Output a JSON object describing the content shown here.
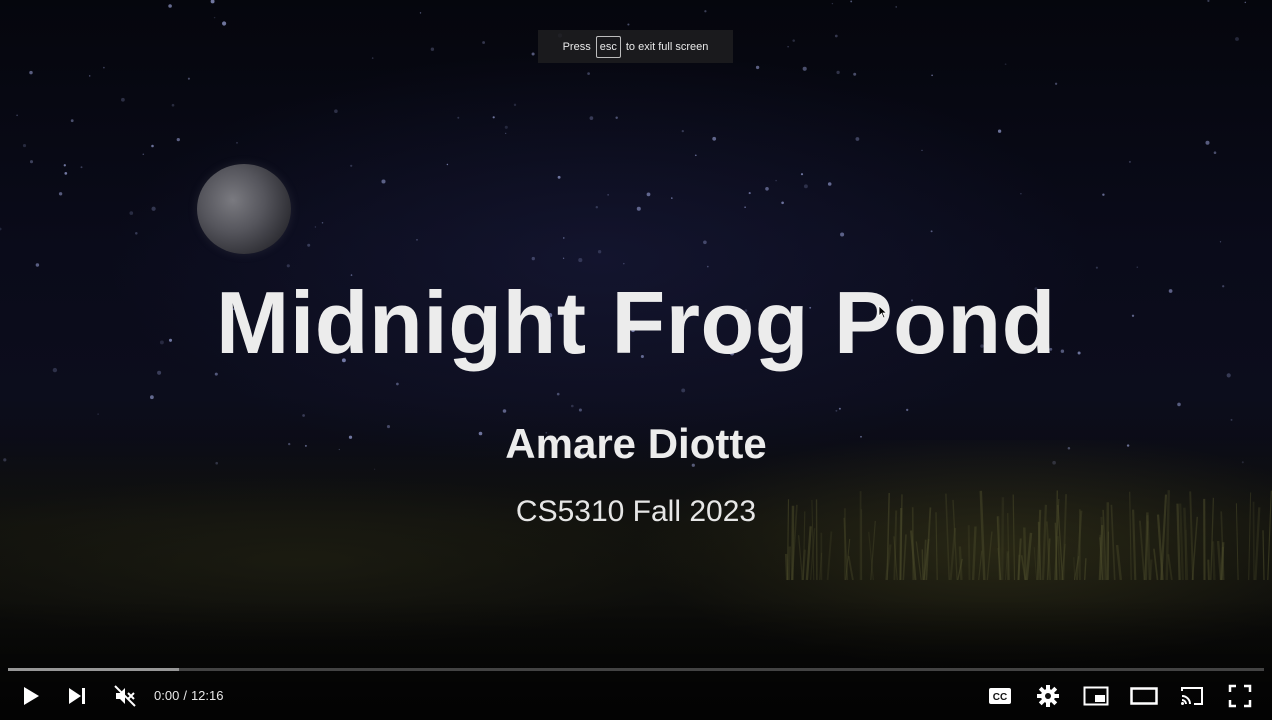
{
  "fullscreen_notice": {
    "press_label": "Press",
    "key_label": "esc",
    "suffix_label": "to exit full screen"
  },
  "slide": {
    "title": "Midnight Frog Pond",
    "author": "Amare Diotte",
    "course": "CS5310 Fall 2023"
  },
  "player": {
    "current_time": "0:00",
    "separator": "/",
    "duration": "12:16",
    "progress_played_fraction": 0.0,
    "progress_loaded_fraction": 0.136,
    "muted": true,
    "accent_color": "#ff0000"
  },
  "controls": {
    "left": [
      "play-icon",
      "next-icon",
      "volume-muted-icon"
    ],
    "right": [
      "captions-icon",
      "settings-gear-icon",
      "miniplayer-icon",
      "theater-mode-icon",
      "cast-icon",
      "fullscreen-exit-icon"
    ]
  }
}
